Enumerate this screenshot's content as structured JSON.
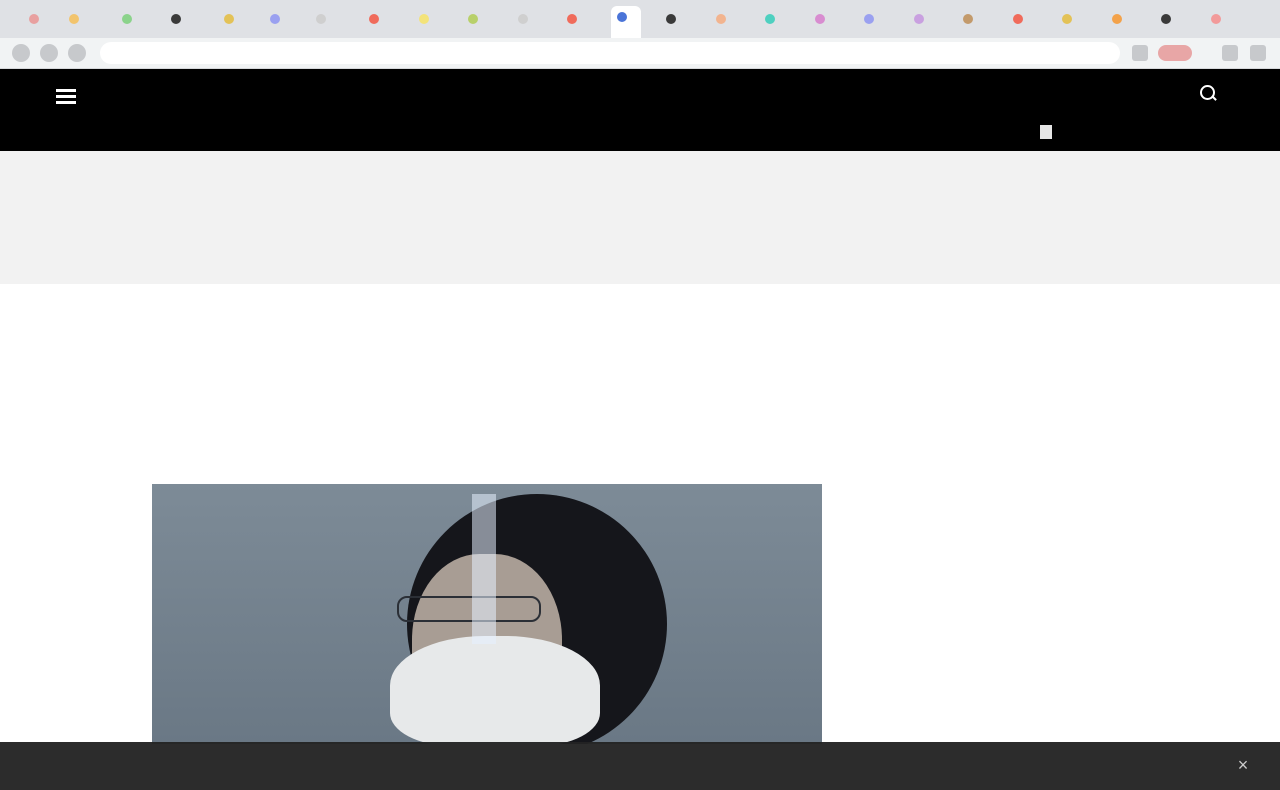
{
  "browser": {
    "tab_colors": [
      "#e8a0a0",
      "#f2c46d",
      "#8bd38b",
      "#3a3a3a",
      "#e3c257",
      "#9aa0f0",
      "#cfcfcf",
      "#f06b5b",
      "#f3e37a",
      "#b8d06a",
      "#cfcfcf",
      "#f06b5b",
      "#4a74d8",
      "#3a3a3a",
      "#f2b48f",
      "#4ed0c0",
      "#d88cd0",
      "#9aa0f0",
      "#c9a0e0",
      "#c39a6b",
      "#f06b5b",
      "#e3c257",
      "#f3a24a",
      "#3a3a3a",
      "#f29a9a"
    ],
    "address": ""
  },
  "site": {
    "logo": "",
    "login_label": "",
    "nav_items": [
      "",
      "",
      "",
      "",
      "",
      "",
      "",
      "",
      "",
      "",
      ""
    ],
    "colors": {
      "header_bg": "#000000",
      "hot_nav": "#ff3b2f"
    }
  },
  "ad": {
    "label": ""
  },
  "article": {
    "breadcrumb": "",
    "headline": "",
    "dek": ""
  },
  "cookie_banner": {
    "text": "",
    "close_label": "×"
  }
}
